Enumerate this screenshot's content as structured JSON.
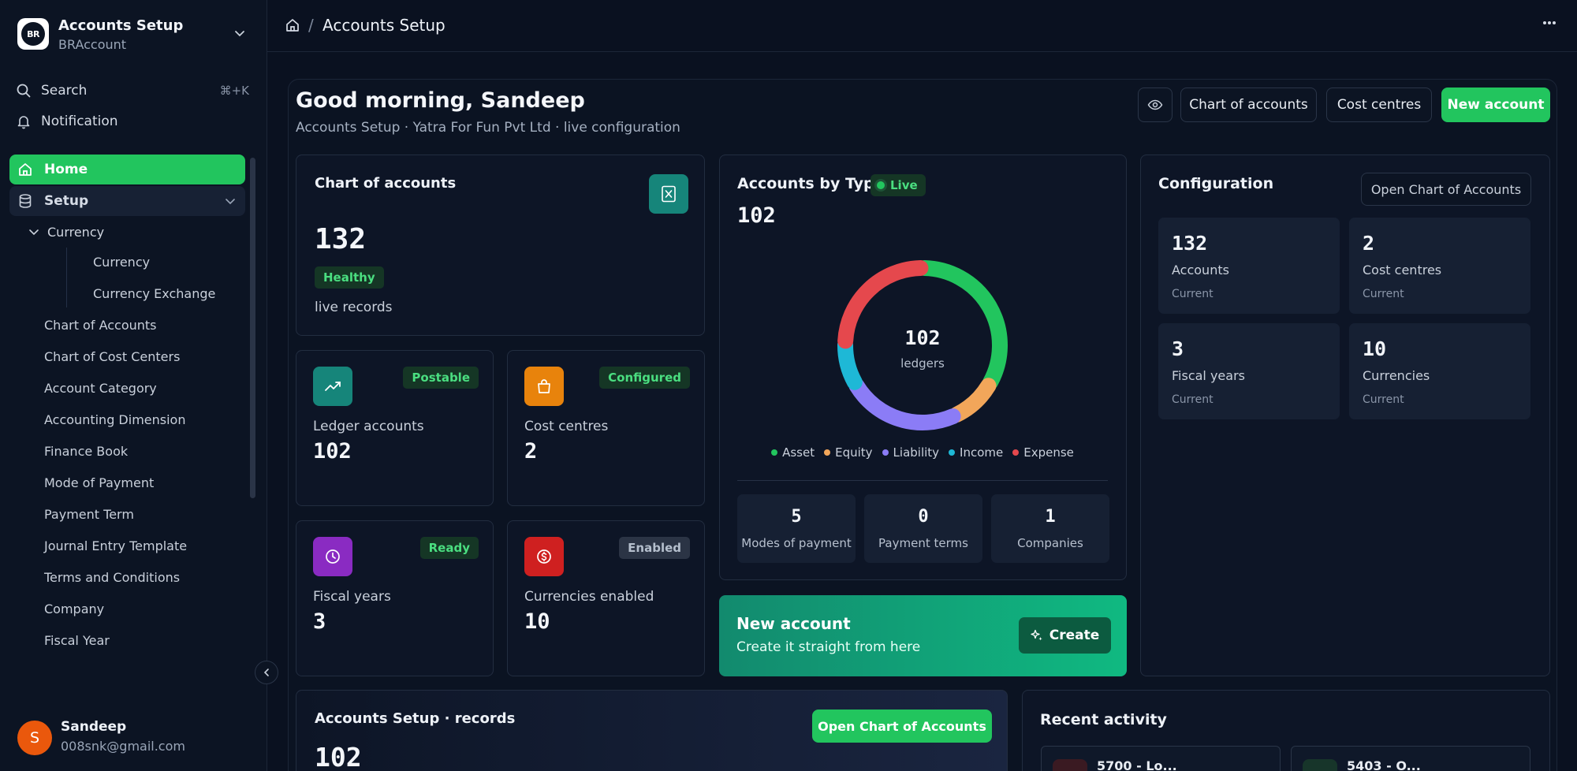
{
  "workspace": {
    "name": "Accounts Setup",
    "org": "BRAccount",
    "logo_text": "BR"
  },
  "sidebar": {
    "search_label": "Search",
    "search_shortcut": "⌘+K",
    "notification_label": "Notification",
    "home_label": "Home",
    "setup_label": "Setup",
    "currency_group": "Currency",
    "currency_children": [
      "Currency",
      "Currency Exchange"
    ],
    "items": [
      "Chart of Accounts",
      "Chart of Cost Centers",
      "Account Category",
      "Accounting Dimension",
      "Finance Book",
      "Mode of Payment",
      "Payment Term",
      "Journal Entry Template",
      "Terms and Conditions",
      "Company",
      "Fiscal Year"
    ]
  },
  "user": {
    "initial": "S",
    "name": "Sandeep",
    "email": "008snk@gmail.com"
  },
  "breadcrumb": {
    "separator": "/",
    "title": "Accounts Setup"
  },
  "header": {
    "greeting": "Good morning, Sandeep",
    "subtitle": "Accounts Setup · Yatra For Fun Pvt Ltd · live configuration",
    "btn_chart": "Chart of accounts",
    "btn_cost": "Cost centres",
    "btn_new": "New account"
  },
  "coa_card": {
    "title": "Chart of accounts",
    "value": "132",
    "badge": "Healthy",
    "caption": "live records"
  },
  "stats": [
    {
      "label": "Ledger accounts",
      "value": "102",
      "badge": "Postable"
    },
    {
      "label": "Cost centres",
      "value": "2",
      "badge": "Configured"
    },
    {
      "label": "Fiscal years",
      "value": "3",
      "badge": "Ready"
    },
    {
      "label": "Currencies enabled",
      "value": "10",
      "badge": "Enabled"
    }
  ],
  "by_type": {
    "title": "Accounts by Type",
    "live": "Live",
    "total": "102",
    "center_value": "102",
    "center_label": "ledgers",
    "mini": [
      {
        "value": "5",
        "label": "Modes of payment"
      },
      {
        "value": "0",
        "label": "Payment terms"
      },
      {
        "value": "1",
        "label": "Companies"
      }
    ]
  },
  "chart_data": {
    "type": "pie",
    "categories": [
      "Asset",
      "Equity",
      "Liability",
      "Income",
      "Expense"
    ],
    "values": [
      34,
      10,
      24,
      9,
      25
    ],
    "colors": [
      "#22c55e",
      "#f2a65a",
      "#8b7cf6",
      "#1eb8d6",
      "#e5484d"
    ],
    "legend": "bottom"
  },
  "cta": {
    "title": "New account",
    "subtitle": "Create it straight from here",
    "button": "Create"
  },
  "config": {
    "title": "Configuration",
    "button": "Open Chart of Accounts",
    "tiles": [
      {
        "value": "132",
        "label": "Accounts",
        "caption": "Current"
      },
      {
        "value": "2",
        "label": "Cost centres",
        "caption": "Current"
      },
      {
        "value": "3",
        "label": "Fiscal years",
        "caption": "Current"
      },
      {
        "value": "10",
        "label": "Currencies",
        "caption": "Current"
      }
    ]
  },
  "records": {
    "title": "Accounts Setup · records",
    "button": "Open Chart of Accounts",
    "value": "102"
  },
  "activity": {
    "title": "Recent activity",
    "items": [
      "5700 - Lo...",
      "5403 - O..."
    ]
  }
}
